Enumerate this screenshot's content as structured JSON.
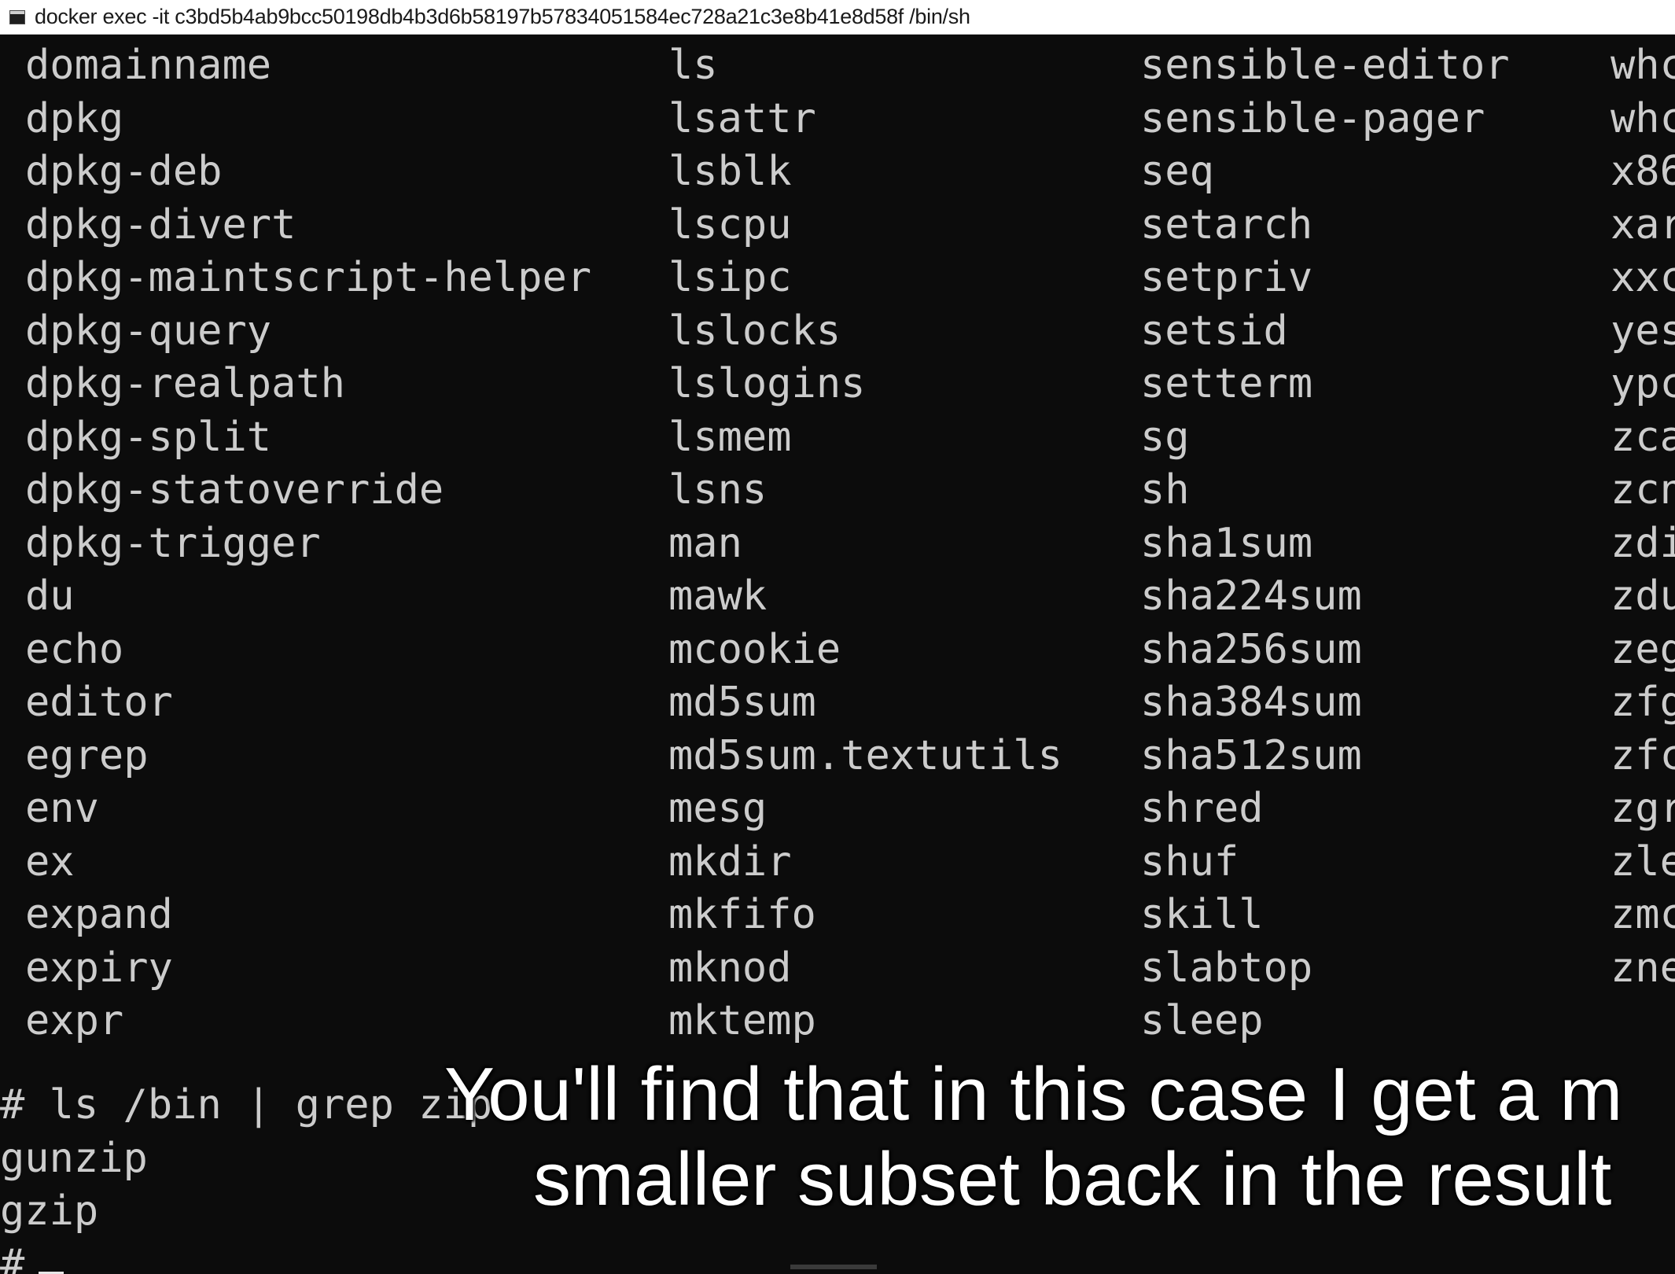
{
  "window": {
    "title": "docker  exec -it c3bd5b4ab9bcc50198db4b3d6b58197b57834051584ec728a21c3e8b41e8d58f /bin/sh"
  },
  "terminal": {
    "columns": [
      {
        "lines": [
          "domainname",
          "dpkg",
          "dpkg-deb",
          "dpkg-divert",
          "dpkg-maintscript-helper",
          "dpkg-query",
          "dpkg-realpath",
          "dpkg-split",
          "dpkg-statoverride",
          "dpkg-trigger",
          "du",
          "echo",
          "editor",
          "egrep",
          "env",
          "ex",
          "expand",
          "expiry",
          "expr"
        ]
      },
      {
        "lines": [
          "ls",
          "lsattr",
          "lsblk",
          "lscpu",
          "lsipc",
          "lslocks",
          "lslogins",
          "lsmem",
          "lsns",
          "man",
          "mawk",
          "mcookie",
          "md5sum",
          "md5sum.textutils",
          "mesg",
          "mkdir",
          "mkfifo",
          "mknod",
          "mktemp"
        ]
      },
      {
        "lines": [
          "sensible-editor",
          "sensible-pager",
          "seq",
          "setarch",
          "setpriv",
          "setsid",
          "setterm",
          "sg",
          "sh",
          "sha1sum",
          "sha224sum",
          "sha256sum",
          "sha384sum",
          "sha512sum",
          "shred",
          "shuf",
          "skill",
          "slabtop",
          "sleep"
        ]
      },
      {
        "lines": [
          "whc",
          "whc",
          "x86",
          "xar",
          "xxc",
          "yes",
          "ypc",
          "zca",
          "zcn",
          "zdi",
          "zdu",
          "zeg",
          "zfg",
          "zfc",
          "zgr",
          "zle",
          "zmc",
          "zne"
        ]
      }
    ],
    "command_line": "# ls /bin | grep zip",
    "output_lines": [
      "gunzip",
      "gzip"
    ],
    "prompt": "#"
  },
  "caption": {
    "line1": "You'll find that in this case I get a m",
    "line2": "smaller subset back in the result"
  }
}
